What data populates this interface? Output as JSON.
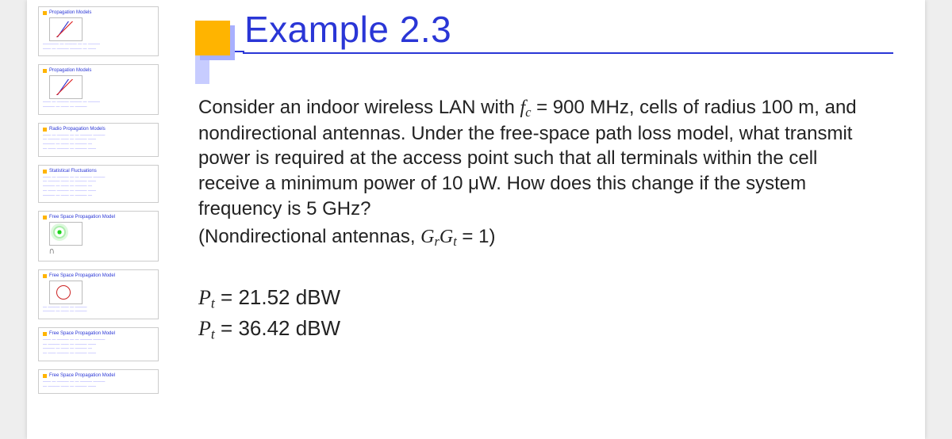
{
  "slide": {
    "title": "Example 2.3",
    "body_line1_a": "Consider an indoor wireless LAN with ",
    "body_line1_b": " = 900 MHz, cells of radius 100 m, and nondirectional antennas. Under the free-space path loss model, what transmit power is required at the access point such that all terminals within the cell receive a minimum power of 10 μW. How does this change if the system frequency is 5 GHz?",
    "body_line2_a": "(Nondirectional antennas, ",
    "body_line2_b": " = 1)",
    "sym_fc_f": "f",
    "sym_fc_c": "c",
    "sym_G": "G",
    "sym_r": "r",
    "sym_t": "t",
    "ans1_a": "P",
    "ans1_b": " = 21.52 dBW",
    "ans2_a": "P",
    "ans2_b": " = 36.42 dBW"
  },
  "thumbs": [
    {
      "title": "Propagation Models",
      "kind": "graph"
    },
    {
      "title": "Propagation Models",
      "kind": "graph"
    },
    {
      "title": "Radio Propagation Models",
      "kind": "text"
    },
    {
      "title": "Statistical Fluctuations",
      "kind": "text"
    },
    {
      "title": "Free Space Propagation Model",
      "kind": "ant"
    },
    {
      "title": "Free Space Propagation Model",
      "kind": "circ"
    },
    {
      "title": "Free Space Propagation Model",
      "kind": "text"
    },
    {
      "title": "Free Space Propagation Model",
      "kind": "text"
    }
  ]
}
